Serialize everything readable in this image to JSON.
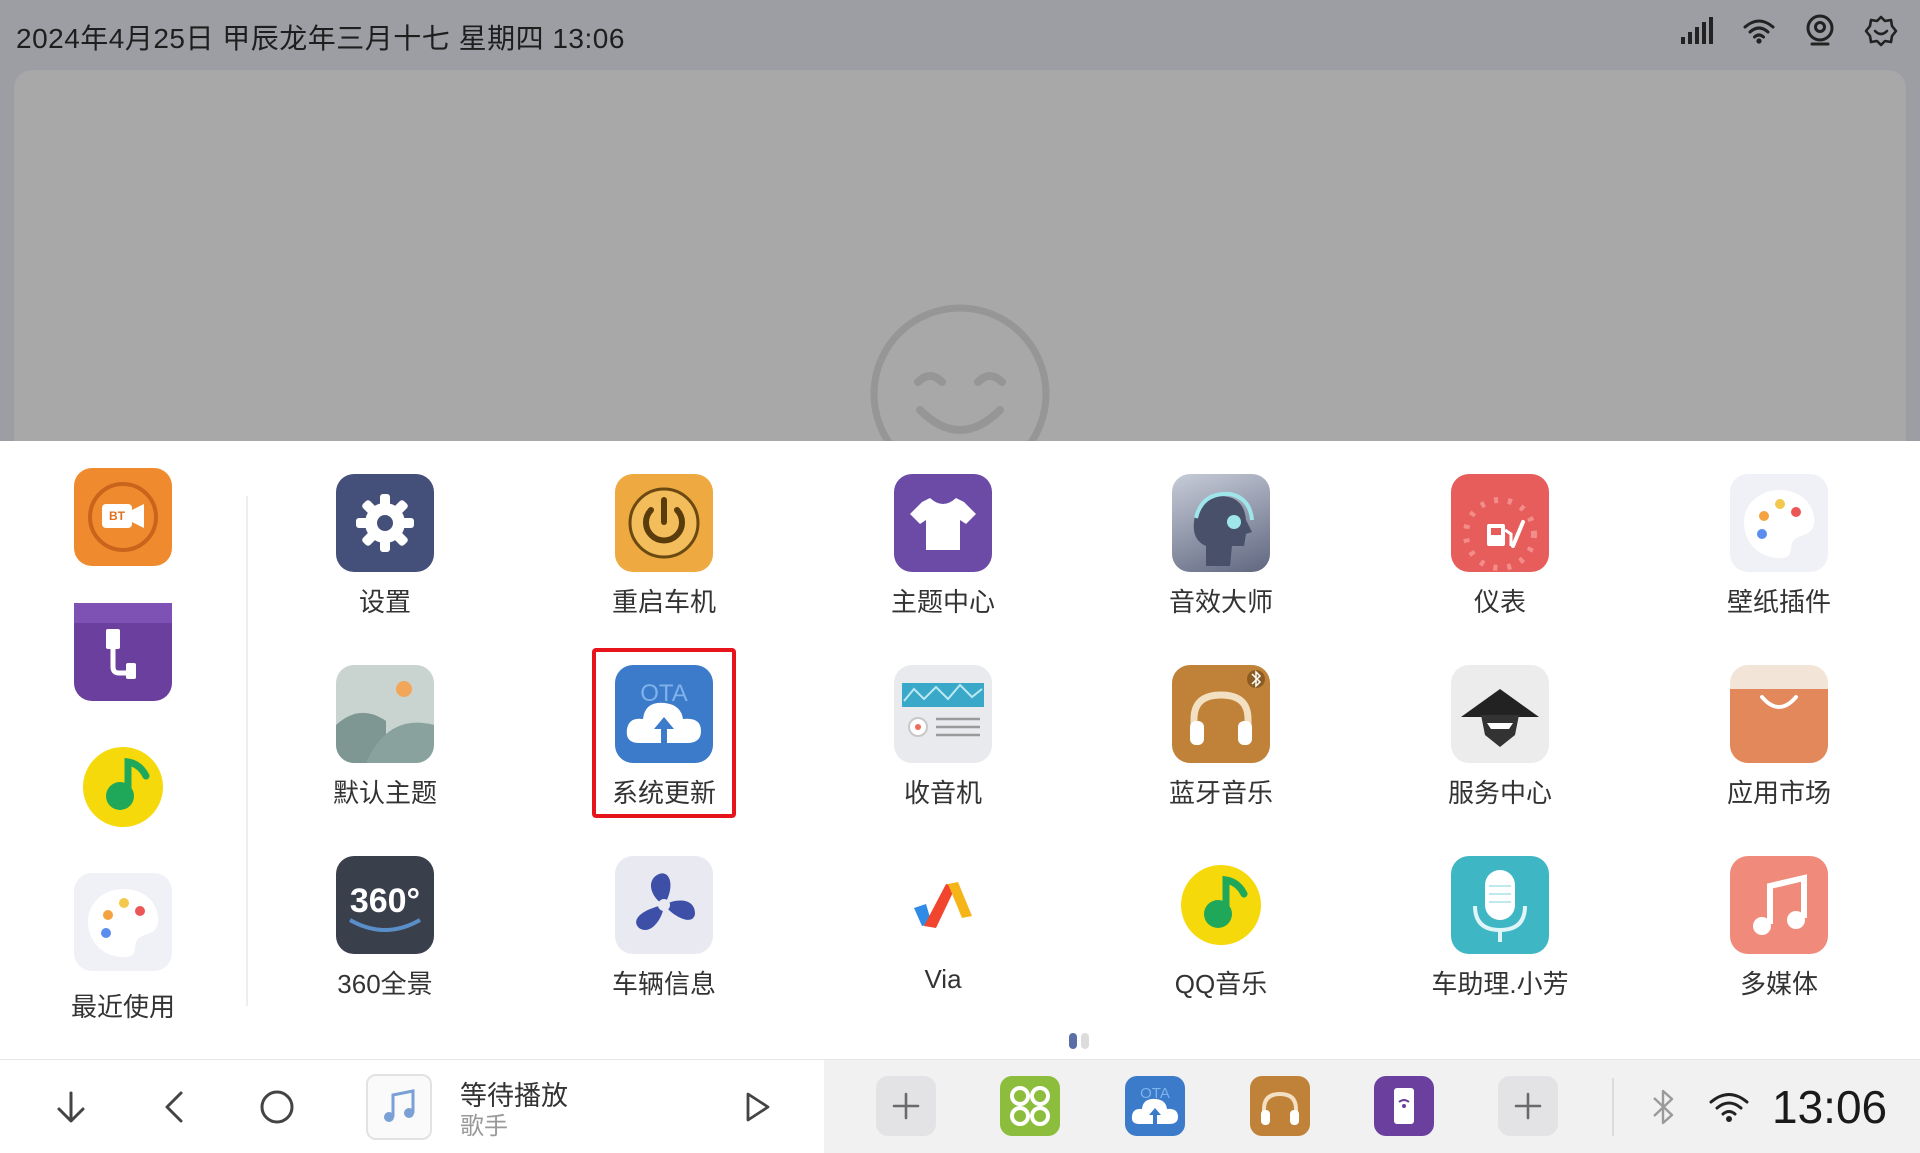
{
  "status_bar": {
    "datetime": "2024年4月25日  甲辰龙年三月十七  星期四  13:06",
    "icons": [
      "signal-icon",
      "wifi-icon",
      "location-icon",
      "settings-icon"
    ]
  },
  "recent": {
    "label": "最近使用",
    "apps": [
      "bt-camera-icon",
      "usb-app-icon",
      "qq-music-icon",
      "wallpaper-plugin-icon"
    ]
  },
  "apps": [
    {
      "label": "设置",
      "icon": "settings-gear-icon"
    },
    {
      "label": "重启车机",
      "icon": "power-icon"
    },
    {
      "label": "主题中心",
      "icon": "tshirt-icon"
    },
    {
      "label": "音效大师",
      "icon": "headphone-head-icon"
    },
    {
      "label": "仪表",
      "icon": "gauge-icon"
    },
    {
      "label": "壁纸插件",
      "icon": "palette-icon"
    },
    {
      "label": "默认主题",
      "icon": "landscape-icon"
    },
    {
      "label": "系统更新",
      "icon": "ota-cloud-icon"
    },
    {
      "label": "收音机",
      "icon": "radio-icon"
    },
    {
      "label": "蓝牙音乐",
      "icon": "bt-headphones-icon"
    },
    {
      "label": "服务中心",
      "icon": "service-hat-icon"
    },
    {
      "label": "应用市场",
      "icon": "shopping-bag-icon"
    },
    {
      "label": "360全景",
      "icon": "camera-360-icon",
      "badge": "360°"
    },
    {
      "label": "车辆信息",
      "icon": "fan-icon"
    },
    {
      "label": "Via",
      "icon": "via-browser-icon"
    },
    {
      "label": "QQ音乐",
      "icon": "qq-music-icon"
    },
    {
      "label": "车助理.小芳",
      "icon": "microphone-icon"
    },
    {
      "label": "多媒体",
      "icon": "music-note-icon"
    }
  ],
  "ota_text": "OTA",
  "bt_badge": "BT",
  "dock": {
    "music_title": "等待播放",
    "music_artist": "歌手",
    "clock": "13:06"
  },
  "colors": {
    "highlight": "#e8141c",
    "status_bar": "#9c9ea4"
  }
}
